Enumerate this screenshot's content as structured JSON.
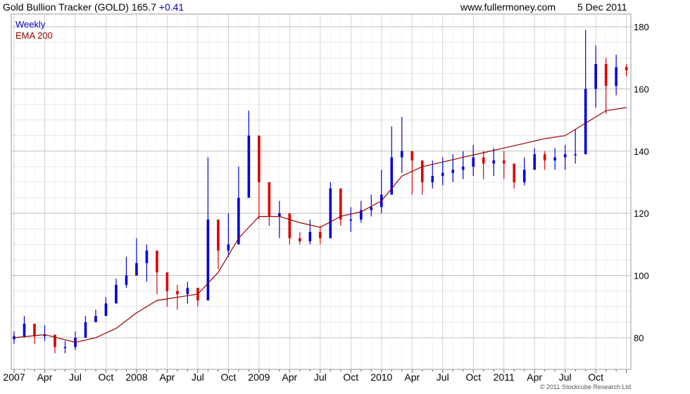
{
  "header": {
    "title": "Gold Bullion Tracker (GOLD) 165.7",
    "change": "+0.41",
    "site": "www.fullermoney.com",
    "date": "5 Dec 2011"
  },
  "legend": {
    "series1": "Weekly",
    "series2": "EMA 200"
  },
  "copyright": "© 2011 Stockcube Research Ltd",
  "colors": {
    "up": "#0000dd",
    "down": "#dd0000",
    "ema": "#990000",
    "grid": "#d8d8d8"
  },
  "chart_data": {
    "type": "line",
    "title": "Gold Bullion Tracker (GOLD)",
    "frequency": "weekly candlesticks",
    "ylim": [
      75,
      182
    ],
    "yticks": [
      80,
      100,
      120,
      140,
      160,
      180
    ],
    "xticks": [
      "2007",
      "Apr",
      "Jul",
      "Oct",
      "2008",
      "Apr",
      "Jul",
      "Oct",
      "2009",
      "Apr",
      "Jul",
      "Oct",
      "2010",
      "Apr",
      "Jul",
      "Oct",
      "2011",
      "Apr",
      "Jul",
      "Oct"
    ],
    "xlim_months": [
      0,
      60.3
    ],
    "grid": true,
    "legend_position": "top-left",
    "series": [
      {
        "name": "Weekly",
        "months": [
          0,
          1,
          2,
          3,
          4,
          5,
          6,
          7,
          8,
          9,
          10,
          11,
          12,
          13,
          14,
          15,
          16,
          17,
          18,
          19,
          20,
          21,
          22,
          23,
          24,
          25,
          26,
          27,
          28,
          29,
          30,
          31,
          32,
          33,
          34,
          35,
          36,
          37,
          38,
          39,
          40,
          41,
          42,
          43,
          44,
          45,
          46,
          47,
          48,
          49,
          50,
          51,
          52,
          53,
          54,
          55,
          56,
          57,
          58,
          59,
          60
        ],
        "close": [
          80.5,
          84.5,
          80.5,
          81,
          77,
          77,
          80,
          85,
          87,
          91,
          97,
          100,
          104,
          108,
          101,
          95,
          94,
          96,
          92,
          118,
          108,
          110,
          125,
          145,
          130,
          119,
          120,
          112,
          111,
          114,
          112,
          128,
          118,
          118,
          121,
          122,
          126,
          138,
          140,
          137,
          130,
          132,
          133,
          134,
          135,
          138,
          136,
          137,
          136,
          130,
          134,
          139,
          137,
          138,
          139,
          139,
          160,
          168,
          161,
          167,
          166
        ],
        "high": [
          82,
          87,
          83,
          84,
          80,
          79,
          82,
          87,
          89,
          93,
          99,
          106,
          112,
          110,
          104,
          98,
          97,
          98,
          96,
          138,
          113,
          120,
          135,
          153,
          136,
          126,
          124,
          116,
          114,
          118,
          116,
          130,
          124,
          122,
          124,
          126,
          134,
          148,
          151,
          140,
          135,
          137,
          138,
          139,
          140,
          142,
          140,
          141,
          140,
          135,
          138,
          141,
          140,
          141,
          142,
          147,
          179,
          174,
          170,
          171,
          168
        ],
        "low": [
          78,
          80,
          78,
          79,
          75,
          75,
          76,
          82,
          85,
          88,
          93,
          96,
          100,
          98,
          94,
          90,
          89,
          91,
          90,
          105,
          102,
          106,
          117,
          128,
          118,
          116,
          112,
          110,
          110,
          110,
          110,
          115,
          116,
          114,
          117,
          119,
          120,
          130,
          133,
          126,
          126,
          128,
          129,
          130,
          131,
          132,
          131,
          132,
          131,
          128,
          129,
          134,
          134,
          134,
          134,
          136,
          145,
          154,
          152,
          158,
          164
        ]
      },
      {
        "name": "EMA 200",
        "months": [
          0,
          3,
          6,
          8,
          10,
          12,
          14,
          16,
          18,
          20,
          22,
          24,
          26,
          28,
          30,
          32,
          34,
          36,
          38,
          40,
          42,
          44,
          46,
          48,
          50,
          52,
          54,
          56,
          58,
          60
        ],
        "values": [
          80,
          81,
          78.5,
          80,
          83,
          88,
          92,
          93,
          94,
          101,
          112,
          119,
          119,
          117,
          115.5,
          119,
          120.5,
          124,
          132,
          135,
          136.5,
          138,
          139.5,
          141,
          142.5,
          144,
          145,
          149,
          153,
          154
        ]
      }
    ]
  }
}
